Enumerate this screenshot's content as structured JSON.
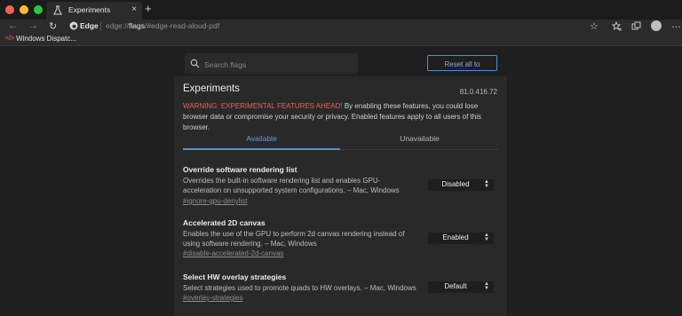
{
  "browser": {
    "tab_title": "Experiments",
    "tab_close": "×",
    "new_tab": "+",
    "site_chip": "Edge",
    "url_prefix": "edge://",
    "url_bold": "flags",
    "url_suffix": "/#edge-read-aloud-pdf",
    "favorite_label": "Windows Dispatc...",
    "favorite_icon": "</>"
  },
  "page": {
    "search_placeholder": "Search flags",
    "reset_label": "Reset all to default",
    "title": "Experiments",
    "version": "81.0.416.72",
    "warning_strong": "WARNING: EXPERIMENTAL FEATURES AHEAD!",
    "warning_text": " By enabling these features, you could lose browser data or compromise your security or privacy. Enabled features apply to all users of this browser.",
    "tabs": {
      "available": "Available",
      "unavailable": "Unavailable"
    },
    "experiments": [
      {
        "name": "Override software rendering list",
        "description": "Overrides the built-in software rendering list and enables GPU-acceleration on unsupported system configurations. – Mac, Windows",
        "link": "#ignore-gpu-denylist",
        "value": "Disabled"
      },
      {
        "name": "Accelerated 2D canvas",
        "description": "Enables the use of the GPU to perform 2d canvas rendering instead of using software rendering. – Mac, Windows",
        "link": "#disable-accelerated-2d-canvas",
        "value": "Enabled"
      },
      {
        "name": "Select HW overlay strategies",
        "description": "Select strategies used to promote quads to HW overlays. – Mac, Windows",
        "link": "#overlay-strategies",
        "value": "Default"
      }
    ]
  },
  "icons": {
    "back": "arrow-left-icon",
    "forward": "arrow-right-icon",
    "refresh": "refresh-icon",
    "star": "star-icon",
    "favorites": "favorites-icon",
    "collections": "collections-icon",
    "menu": "more-icon",
    "search": "search-icon"
  },
  "colors": {
    "accent": "#4f8fd6",
    "warning": "#e5625c"
  }
}
